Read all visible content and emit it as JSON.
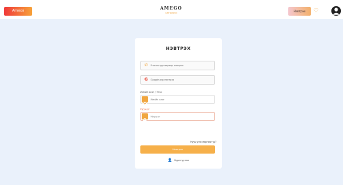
{
  "header": {
    "left_badge": "Amexо",
    "brand_name": "AMEGO",
    "brand_sub": "каталоги",
    "login_label": "Нэвтрэх",
    "heart_icon": "heart-icon",
    "user_icon": "user-icon"
  },
  "login": {
    "title": "НЭВТРЭХ",
    "phone_social": "Утасны дугаараар нэвтрэх",
    "google_social": "Google-ээр нэвтрэх",
    "email_label": "Имэйл хаяг / Утас",
    "email_placeholder": "Имэйл хаяг",
    "password_label": "Нууц үг",
    "password_placeholder": "Нууц үг",
    "forgot_link": "Нууц үгээ мартсан уу?",
    "submit_label": "Нэвтрэх",
    "register_link": "Бүртгүүлэх"
  },
  "colors": {
    "accent": "#f6b04a",
    "label_red": "#e85c2f",
    "page_bg": "#eaf1fb"
  }
}
